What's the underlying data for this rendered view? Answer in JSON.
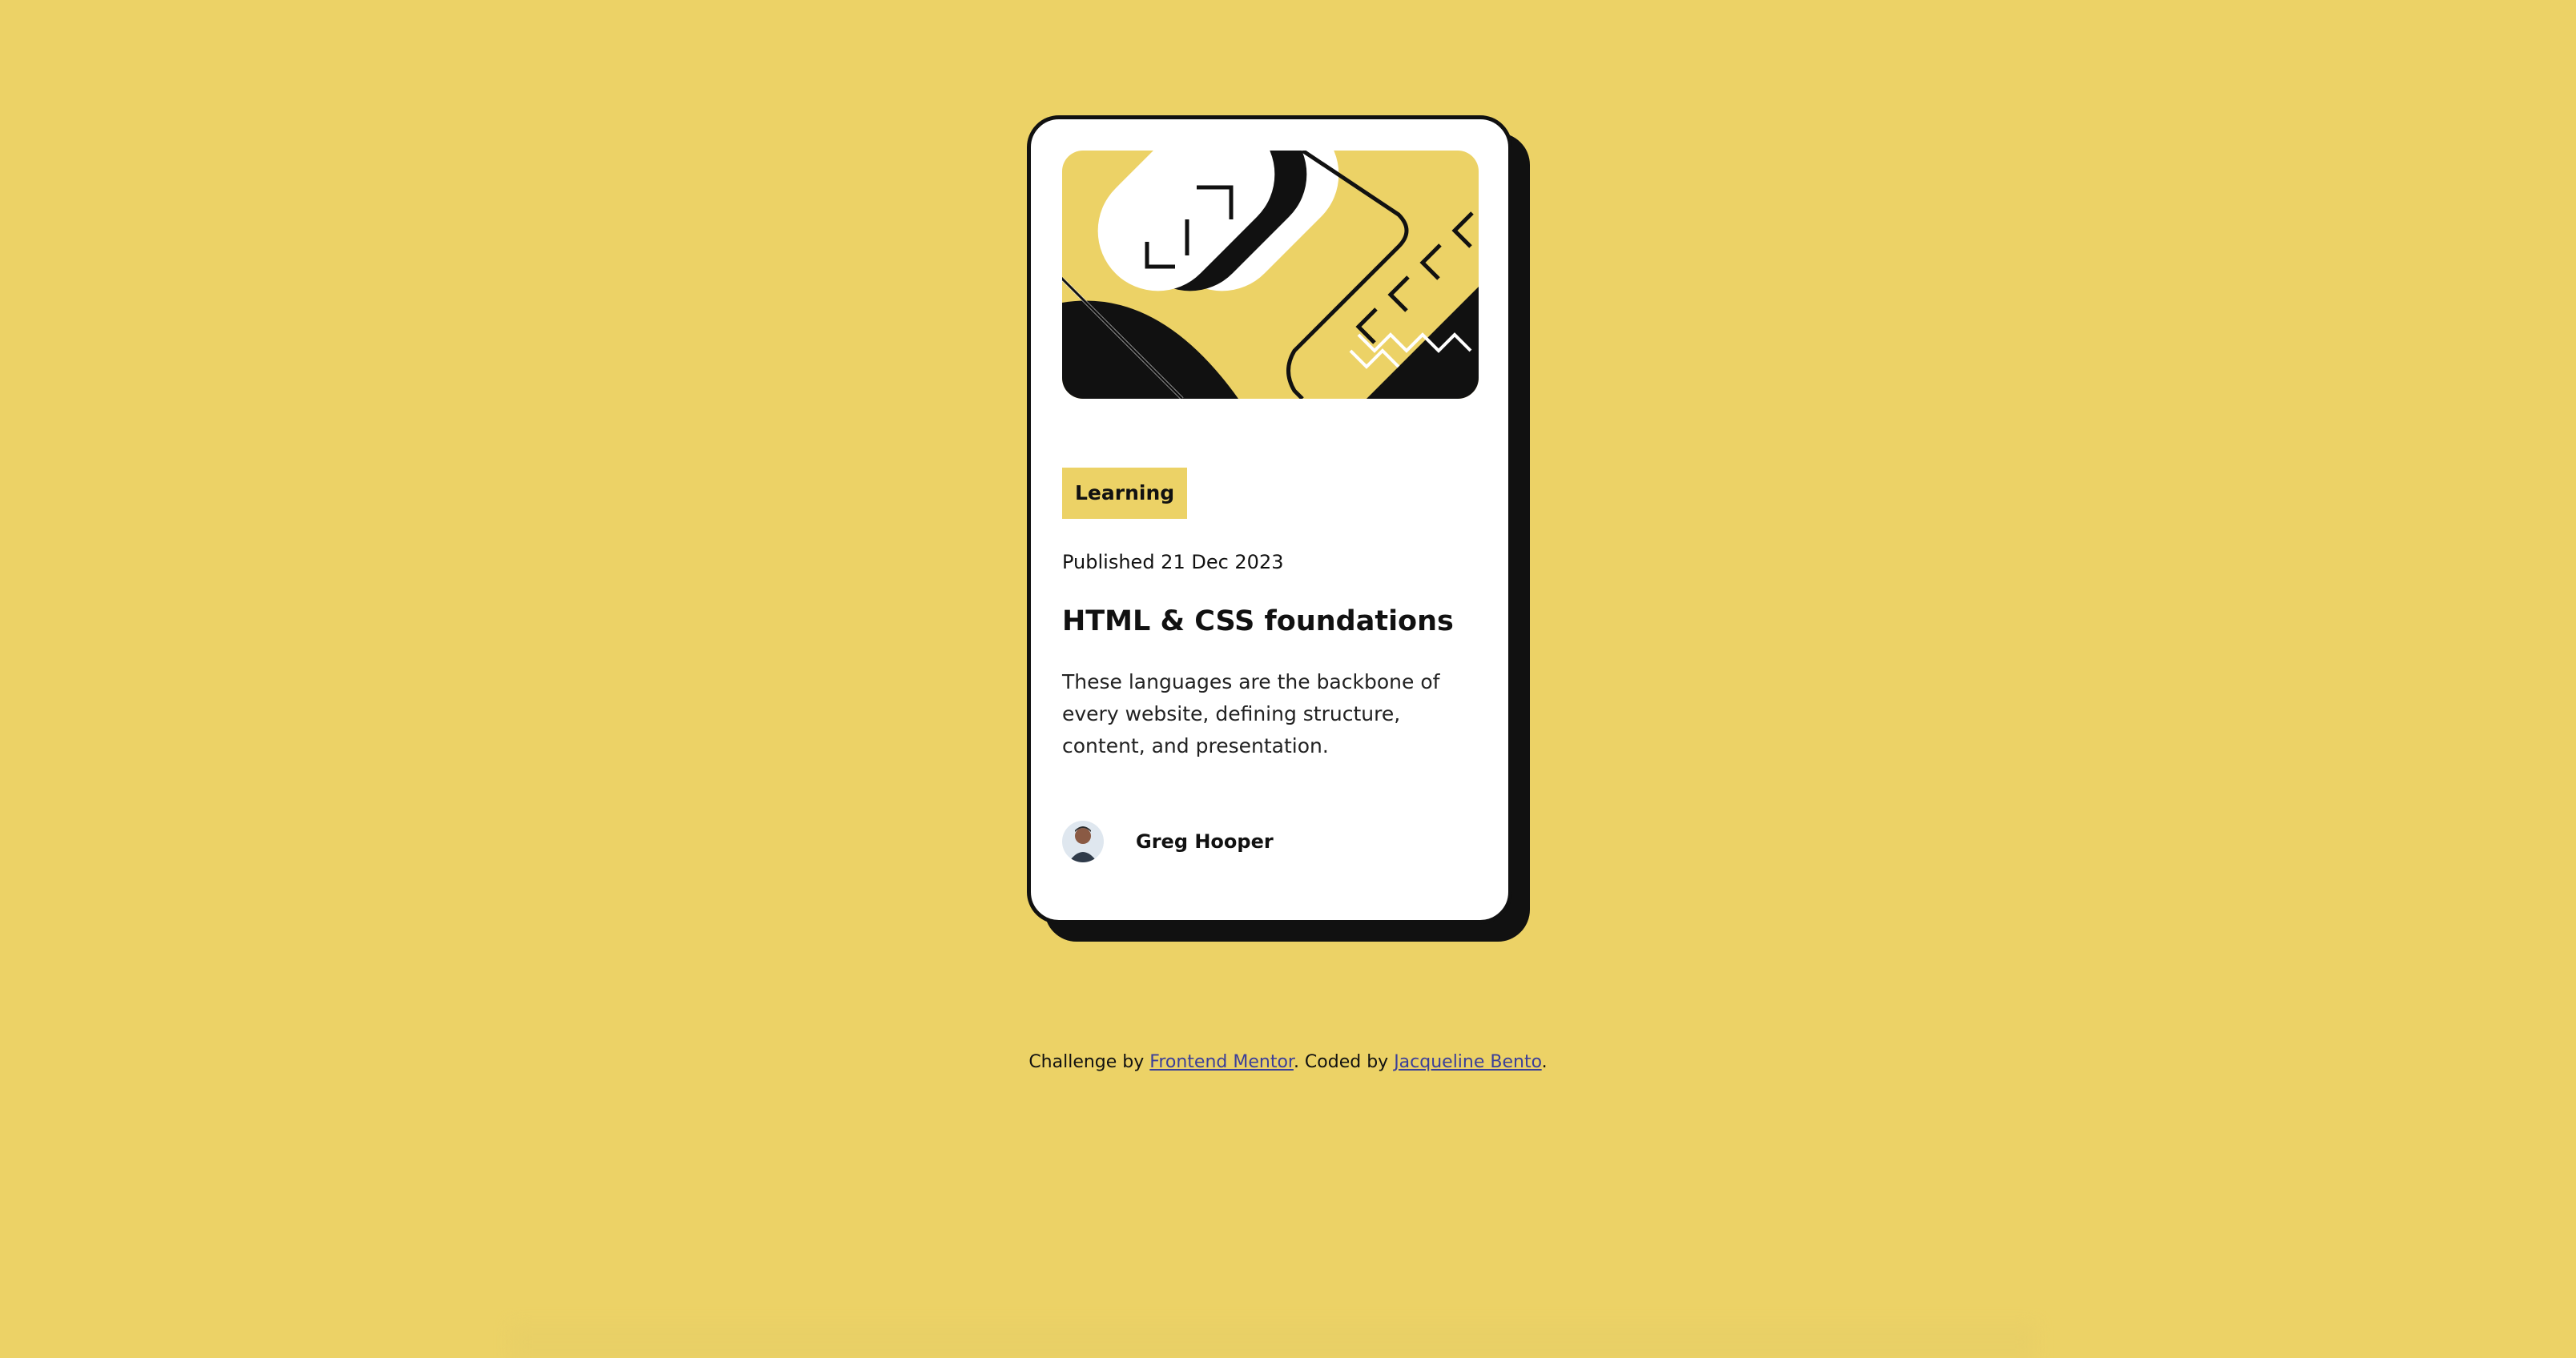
{
  "card": {
    "category": "Learning",
    "published": "Published 21 Dec 2023",
    "title": "HTML & CSS foundations",
    "description": "These languages are the backbone of every website, defining structure, content, and presentation.",
    "author": {
      "name": "Greg Hooper"
    }
  },
  "attribution": {
    "prefix": "Challenge by ",
    "link1": "Frontend Mentor",
    "middle": ". Coded by ",
    "link2": "Jacqueline Bento",
    "suffix": "."
  },
  "colors": {
    "background": "#ecd266",
    "card": "#ffffff",
    "ink": "#111111",
    "link": "#3b3f99"
  }
}
